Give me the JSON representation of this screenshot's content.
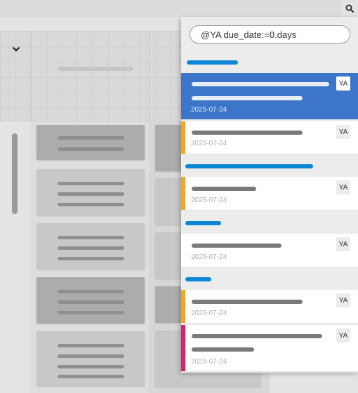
{
  "search": {
    "query": "@YA due_date:=0.days"
  },
  "results": [
    {
      "initials": "YA",
      "date": "2025-07-24",
      "accent": ""
    },
    {
      "initials": "YA",
      "date": "2025-07-24",
      "accent": "#f5a623"
    },
    {
      "initials": "YA",
      "date": "2025-07-24",
      "accent": "#f5a623"
    },
    {
      "initials": "YA",
      "date": "2025-07-24",
      "accent": ""
    },
    {
      "initials": "YA",
      "date": "2025-07-24",
      "accent": "#f5a623"
    },
    {
      "initials": "YA",
      "date": "2025-07-24",
      "accent": "#e0206a"
    }
  ],
  "colors": {
    "group_bar": "#0b86d6",
    "selected": "#3d76c8"
  },
  "icons": {
    "search": "search-icon",
    "collapse": "chevron-down-icon"
  }
}
